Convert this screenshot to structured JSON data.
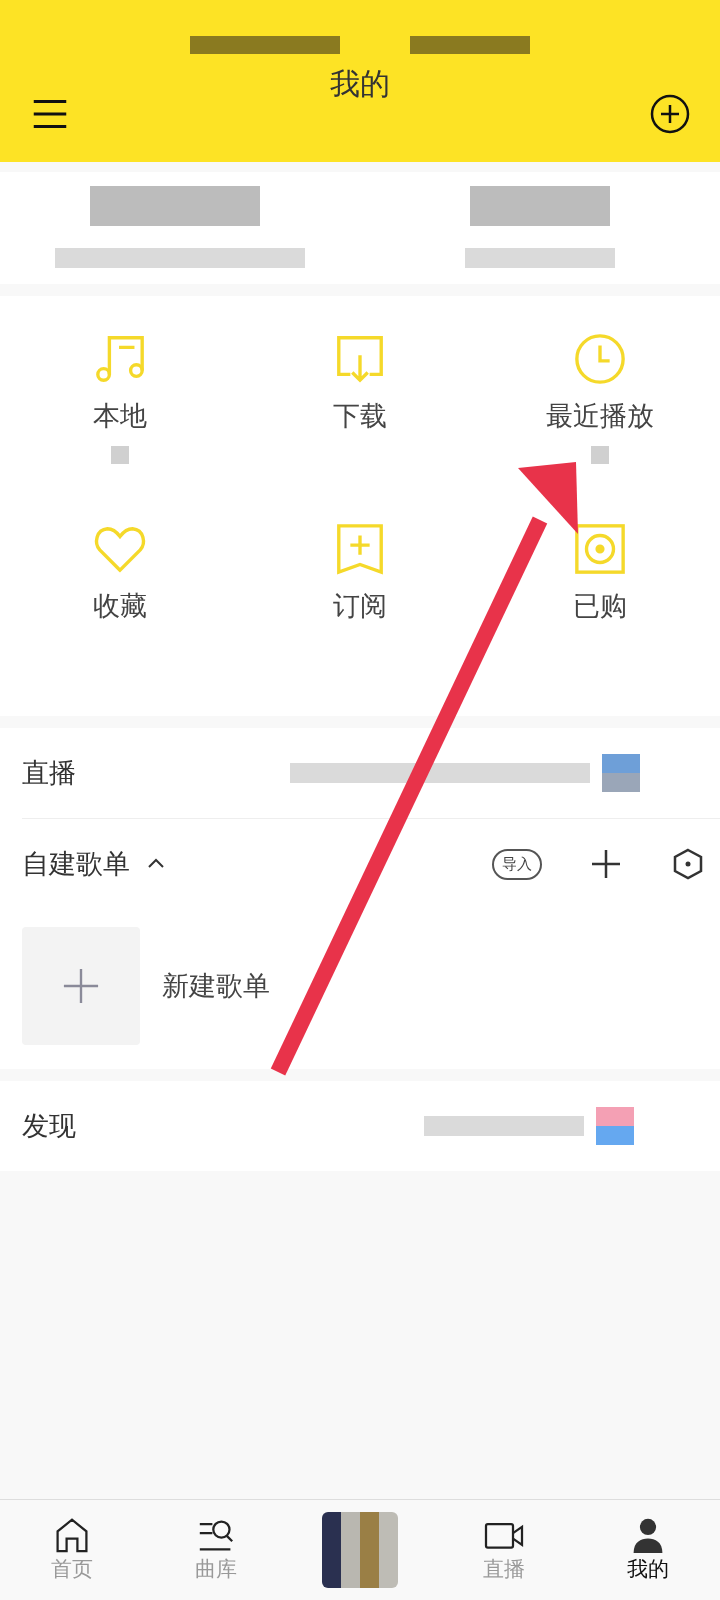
{
  "header": {
    "title": "我的"
  },
  "shortcuts": [
    {
      "label": "本地"
    },
    {
      "label": "下载"
    },
    {
      "label": "最近播放"
    },
    {
      "label": "收藏"
    },
    {
      "label": "订阅"
    },
    {
      "label": "已购"
    }
  ],
  "live": {
    "title": "直播"
  },
  "playlists": {
    "title": "自建歌单",
    "expanded": true,
    "import_label": "导入",
    "new_label": "新建歌单"
  },
  "discover": {
    "title": "发现"
  },
  "tabbar": [
    {
      "kind": "tab",
      "label": "首页",
      "selected": false
    },
    {
      "kind": "tab",
      "label": "曲库",
      "selected": false
    },
    {
      "kind": "avatar"
    },
    {
      "kind": "tab",
      "label": "直播",
      "selected": false
    },
    {
      "kind": "tab",
      "label": "我的",
      "selected": true
    }
  ]
}
